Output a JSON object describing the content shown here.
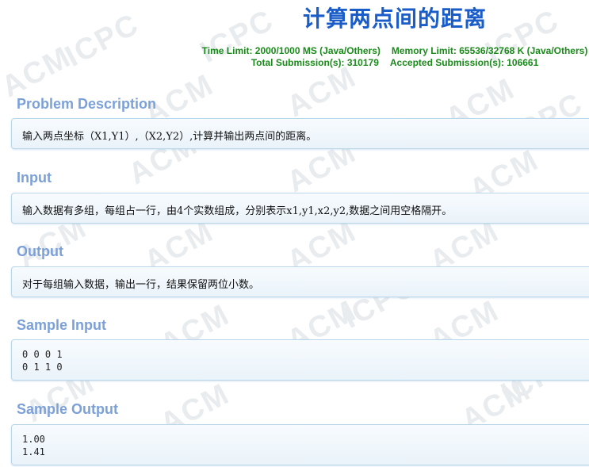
{
  "title": "计算两点间的距离",
  "limits": {
    "time_limit": "Time Limit: 2000/1000 MS (Java/Others)",
    "memory_limit": "Memory Limit: 65536/32768 K (Java/Others)",
    "total_submissions": "Total Submission(s): 310179",
    "accepted_submissions": "Accepted Submission(s): 106661"
  },
  "sections": {
    "description": {
      "heading": "Problem Description",
      "text": "输入两点坐标（X1,Y1）,（X2,Y2）,计算并输出两点间的距离。"
    },
    "input": {
      "heading": "Input",
      "text": "输入数据有多组，每组占一行，由4个实数组成，分别表示x1,y1,x2,y2,数据之间用空格隔开。"
    },
    "output": {
      "heading": "Output",
      "text": "对于每组输入数据，输出一行，结果保留两位小数。"
    },
    "sample_input": {
      "heading": "Sample Input",
      "text": "0 0 0 1\n0 1 1 0"
    },
    "sample_output": {
      "heading": "Sample Output",
      "text": "1.00\n1.41"
    }
  },
  "watermark": {
    "acm": "ACM",
    "icpc": "ICPC"
  },
  "colors": {
    "title": "#1a5cc8",
    "limits": "#1a8a1a",
    "section_heading": "#7ca0d8",
    "panel_border": "#b9d6ea"
  }
}
